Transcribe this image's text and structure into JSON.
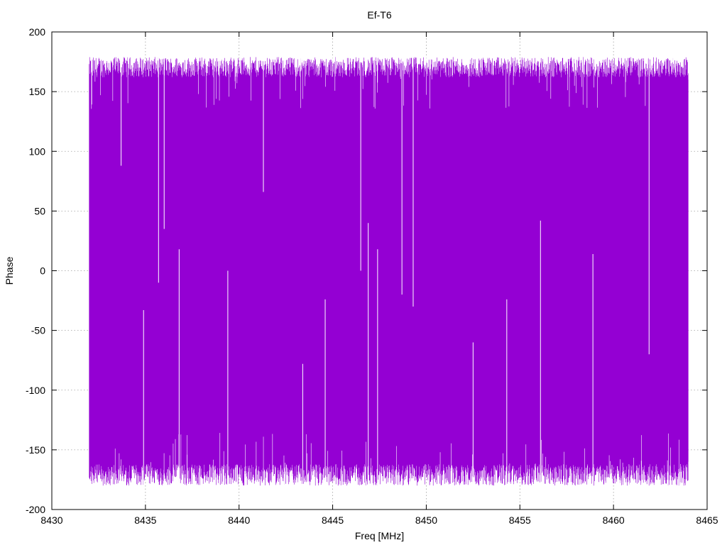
{
  "chart_data": {
    "type": "line",
    "title": "Ef-T6",
    "xlabel": "Freq [MHz]",
    "ylabel": "Phase",
    "xlim": [
      8430,
      8465
    ],
    "ylim": [
      -200,
      200
    ],
    "x_ticks": [
      8430,
      8435,
      8440,
      8445,
      8450,
      8455,
      8460,
      8465
    ],
    "y_ticks": [
      -200,
      -150,
      -100,
      -50,
      0,
      50,
      100,
      150,
      200
    ],
    "x_tick_labels": [
      "8430",
      "8435",
      "8440",
      "8445",
      "8450",
      "8455",
      "8460",
      "8465"
    ],
    "y_tick_labels": [
      "-200",
      "-150",
      "-100",
      "-50",
      "0",
      "50",
      "100",
      "150",
      "200"
    ],
    "grid": true,
    "series": [
      {
        "color": "#9400d3",
        "x_range": [
          8432,
          8464
        ],
        "y_envelope": [
          -180,
          180
        ],
        "description_pattern": "phase wrapping noise filling full range"
      }
    ],
    "gaps": [
      {
        "x": 8433.7,
        "y_low": 88,
        "y_high": 180
      },
      {
        "x": 8434.9,
        "y_low": -180,
        "y_high": -33
      },
      {
        "x": 8435.7,
        "y_low": -10,
        "y_high": 180
      },
      {
        "x": 8436.0,
        "y_low": 35,
        "y_high": 180
      },
      {
        "x": 8436.8,
        "y_low": -180,
        "y_high": 18
      },
      {
        "x": 8439.4,
        "y_low": -180,
        "y_high": 0
      },
      {
        "x": 8441.3,
        "y_low": 66,
        "y_high": 180
      },
      {
        "x": 8443.4,
        "y_low": -180,
        "y_high": -78
      },
      {
        "x": 8444.6,
        "y_low": -180,
        "y_high": -24
      },
      {
        "x": 8446.5,
        "y_low": 0,
        "y_high": 180
      },
      {
        "x": 8446.9,
        "y_low": -180,
        "y_high": 40
      },
      {
        "x": 8447.4,
        "y_low": -180,
        "y_high": 18
      },
      {
        "x": 8448.7,
        "y_low": -20,
        "y_high": 180
      },
      {
        "x": 8449.3,
        "y_low": -30,
        "y_high": 180
      },
      {
        "x": 8452.5,
        "y_low": -180,
        "y_high": -60
      },
      {
        "x": 8454.3,
        "y_low": -180,
        "y_high": -24
      },
      {
        "x": 8456.1,
        "y_low": -180,
        "y_high": 42
      },
      {
        "x": 8458.9,
        "y_low": -180,
        "y_high": 14
      },
      {
        "x": 8461.9,
        "y_low": -70,
        "y_high": 180
      }
    ]
  }
}
